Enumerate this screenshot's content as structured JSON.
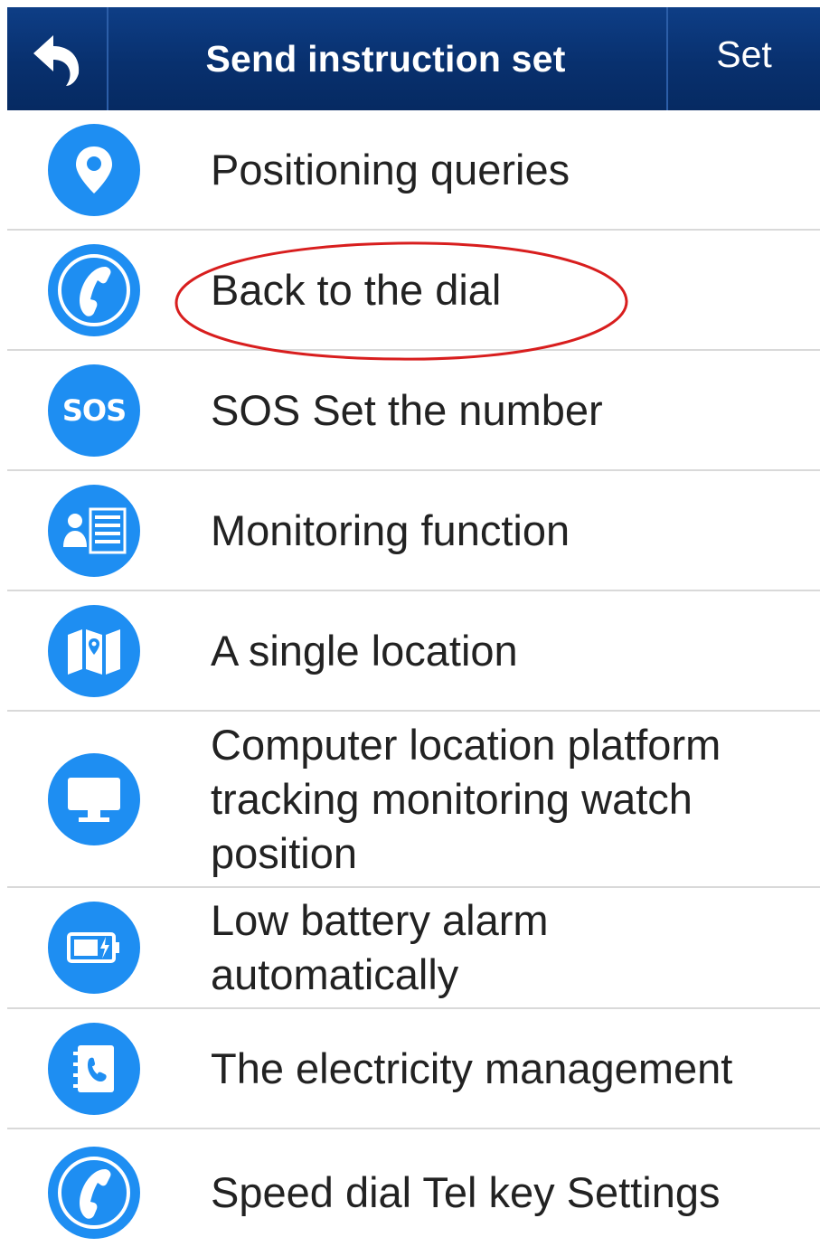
{
  "header": {
    "title": "Send instruction set",
    "set_label": "Set",
    "back_icon": "back-arrow-icon"
  },
  "items": [
    {
      "label": "Positioning queries",
      "icon": "location-pin-icon"
    },
    {
      "label": "Back to the dial",
      "icon": "phone-handset-icon"
    },
    {
      "label": "SOS Set the number",
      "icon": "sos-icon",
      "icon_text": "SOS"
    },
    {
      "label": "Monitoring function",
      "icon": "contact-list-icon"
    },
    {
      "label": "A single location",
      "icon": "map-icon"
    },
    {
      "label": "Computer location platform tracking monitoring watch position",
      "icon": "monitor-icon"
    },
    {
      "label": "Low battery alarm automatically",
      "icon": "battery-icon"
    },
    {
      "label": "The electricity management",
      "icon": "phone-book-icon"
    },
    {
      "label": "Speed dial Tel key Settings",
      "icon": "phone-handset-icon"
    }
  ],
  "colors": {
    "header_bg": "#08306e",
    "icon_bg": "#1e8ef2",
    "divider": "#d9d9d9",
    "highlight_ring": "#d81e1e",
    "text": "#222222"
  }
}
